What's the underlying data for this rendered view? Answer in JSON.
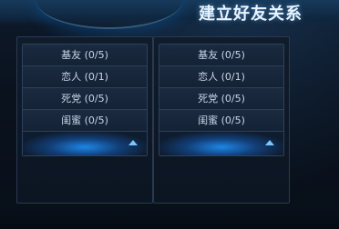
{
  "header": {
    "title": "建立好友关系"
  },
  "panels": [
    {
      "items": [
        {
          "label": "基友 (0/5)"
        },
        {
          "label": "恋人 (0/1)"
        },
        {
          "label": "死党 (0/5)"
        },
        {
          "label": "闺蜜 (0/5)"
        }
      ]
    },
    {
      "items": [
        {
          "label": "基友 (0/5)"
        },
        {
          "label": "恋人 (0/1)"
        },
        {
          "label": "死党 (0/5)"
        },
        {
          "label": "闺蜜 (0/5)"
        }
      ]
    }
  ],
  "icons": {
    "collapse": "chevron-up-icon"
  },
  "colors": {
    "accent": "#1e8cf0",
    "text": "#c7d5e6",
    "title": "#e9f4ff"
  }
}
